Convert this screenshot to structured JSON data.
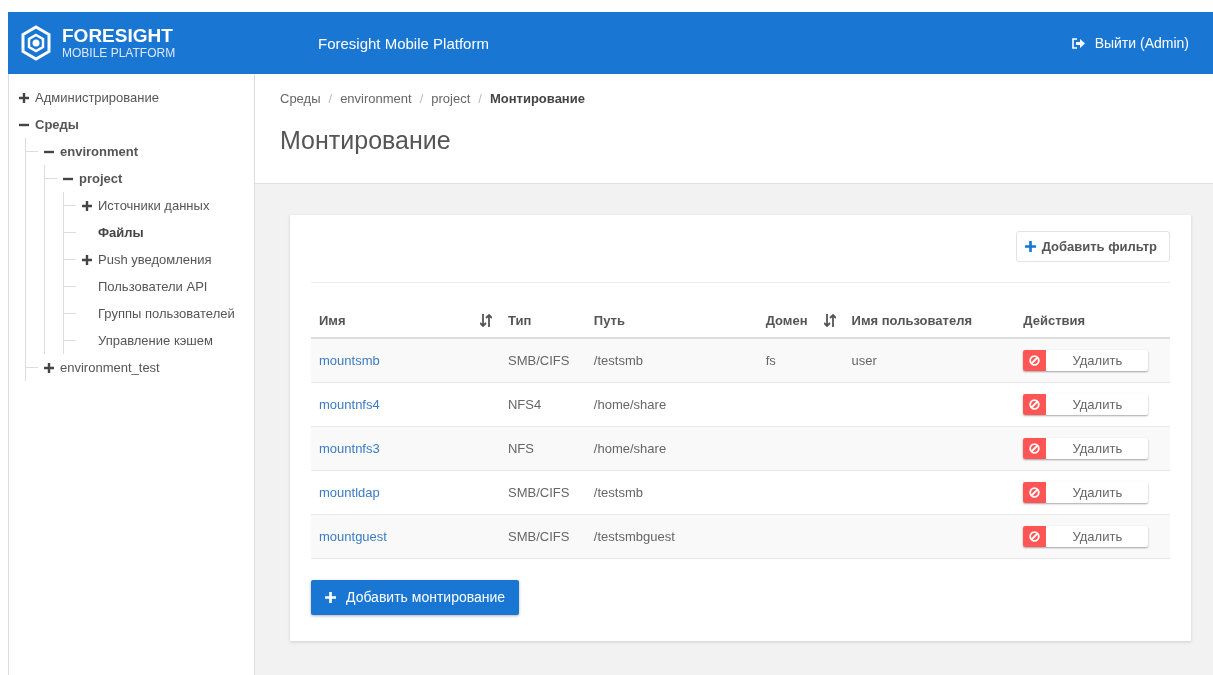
{
  "header": {
    "logo_title": "FORESIGHT",
    "logo_subtitle": "MOBILE PLATFORM",
    "app_title": "Foresight Mobile Platform",
    "logout": "Выйти (Admin)"
  },
  "sidebar": {
    "items": [
      {
        "label": "Администрирование",
        "kind": "group",
        "expanded": false,
        "selected": false
      },
      {
        "label": "Среды",
        "kind": "group",
        "expanded": true,
        "selected": false,
        "children": [
          {
            "label": "environment",
            "kind": "group",
            "expanded": true,
            "selected": false,
            "children": [
              {
                "label": "project",
                "kind": "group",
                "expanded": true,
                "selected": false,
                "children": [
                  {
                    "label": "Источники данных",
                    "kind": "group",
                    "expanded": false,
                    "selected": false
                  },
                  {
                    "label": "Файлы",
                    "kind": "leaf",
                    "selected": true
                  },
                  {
                    "label": "Push уведомления",
                    "kind": "group",
                    "expanded": false,
                    "selected": false
                  },
                  {
                    "label": "Пользователи API",
                    "kind": "leaf",
                    "selected": false
                  },
                  {
                    "label": "Группы пользователей",
                    "kind": "leaf",
                    "selected": false
                  },
                  {
                    "label": "Управление кэшем",
                    "kind": "leaf",
                    "selected": false
                  }
                ]
              }
            ]
          },
          {
            "label": "environment_test",
            "kind": "group",
            "expanded": false,
            "selected": false
          }
        ]
      }
    ]
  },
  "breadcrumb": {
    "separator": "/",
    "items": [
      "Среды",
      "environment",
      "project",
      "Монтирование"
    ]
  },
  "page_title": "Монтирование",
  "filter_button": "Добавить фильтр",
  "table": {
    "columns": [
      {
        "label": "Имя",
        "sortable": true
      },
      {
        "label": "Тип",
        "sortable": false
      },
      {
        "label": "Путь",
        "sortable": false
      },
      {
        "label": "Домен",
        "sortable": true
      },
      {
        "label": "Имя пользователя",
        "sortable": false
      },
      {
        "label": "Действия",
        "sortable": false
      }
    ],
    "rows": [
      {
        "name": "mountsmb",
        "type": "SMB/CIFS",
        "path": "/testsmb",
        "domain": "fs",
        "user": "user",
        "action": "Удалить"
      },
      {
        "name": "mountnfs4",
        "type": "NFS4",
        "path": "/home/share",
        "action": "Удалить"
      },
      {
        "name": "mountnfs3",
        "type": "NFS",
        "path": "/home/share",
        "action": "Удалить"
      },
      {
        "name": "mountldap",
        "type": "SMB/CIFS",
        "path": "/testsmb",
        "action": "Удалить"
      },
      {
        "name": "mountguest",
        "type": "SMB/CIFS",
        "path": "/testsmbguest",
        "action": "Удалить"
      }
    ]
  },
  "add_button": "Добавить монтирование"
}
